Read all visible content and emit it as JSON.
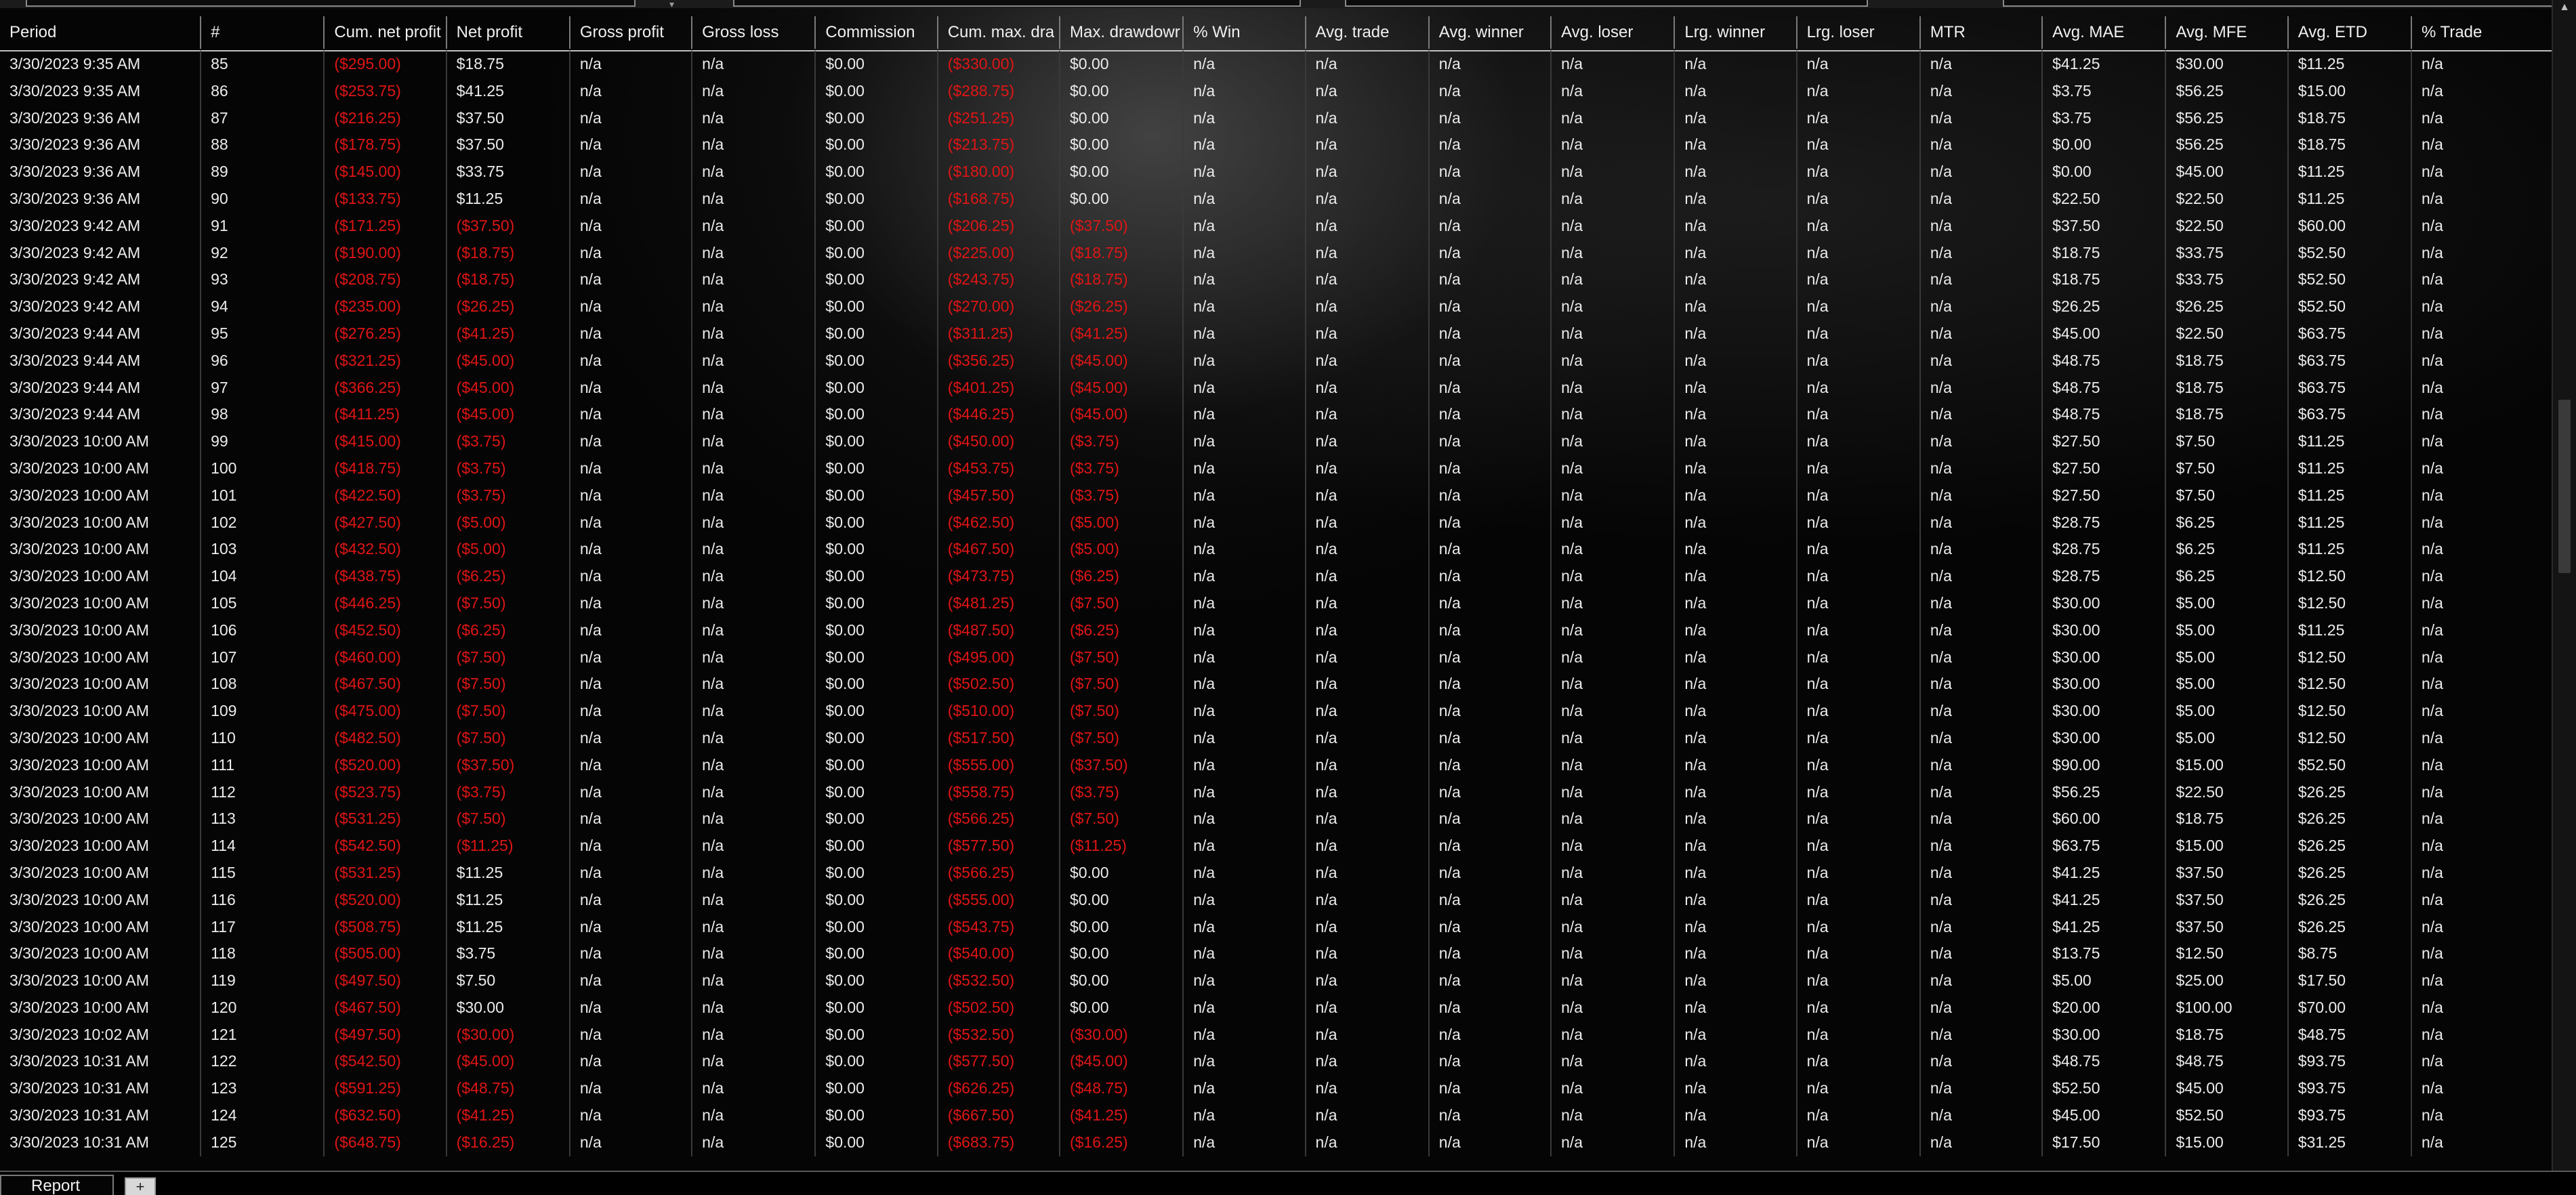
{
  "columns": [
    "Period",
    "#",
    "Cum. net profit",
    "Net profit",
    "Gross profit",
    "Gross loss",
    "Commission",
    "Cum. max. dra",
    "Max. drawdowr",
    "% Win",
    "Avg. trade",
    "Avg. winner",
    "Avg. loser",
    "Lrg. winner",
    "Lrg. loser",
    "MTR",
    "Avg. MAE",
    "Avg. MFE",
    "Avg. ETD",
    "% Trade"
  ],
  "rows": [
    [
      "3/30/2023 9:35 AM",
      "85",
      "($295.00)",
      "$18.75",
      "n/a",
      "n/a",
      "$0.00",
      "($330.00)",
      "$0.00",
      "n/a",
      "n/a",
      "n/a",
      "n/a",
      "n/a",
      "n/a",
      "n/a",
      "$41.25",
      "$30.00",
      "$11.25",
      "n/a"
    ],
    [
      "3/30/2023 9:35 AM",
      "86",
      "($253.75)",
      "$41.25",
      "n/a",
      "n/a",
      "$0.00",
      "($288.75)",
      "$0.00",
      "n/a",
      "n/a",
      "n/a",
      "n/a",
      "n/a",
      "n/a",
      "n/a",
      "$3.75",
      "$56.25",
      "$15.00",
      "n/a"
    ],
    [
      "3/30/2023 9:36 AM",
      "87",
      "($216.25)",
      "$37.50",
      "n/a",
      "n/a",
      "$0.00",
      "($251.25)",
      "$0.00",
      "n/a",
      "n/a",
      "n/a",
      "n/a",
      "n/a",
      "n/a",
      "n/a",
      "$3.75",
      "$56.25",
      "$18.75",
      "n/a"
    ],
    [
      "3/30/2023 9:36 AM",
      "88",
      "($178.75)",
      "$37.50",
      "n/a",
      "n/a",
      "$0.00",
      "($213.75)",
      "$0.00",
      "n/a",
      "n/a",
      "n/a",
      "n/a",
      "n/a",
      "n/a",
      "n/a",
      "$0.00",
      "$56.25",
      "$18.75",
      "n/a"
    ],
    [
      "3/30/2023 9:36 AM",
      "89",
      "($145.00)",
      "$33.75",
      "n/a",
      "n/a",
      "$0.00",
      "($180.00)",
      "$0.00",
      "n/a",
      "n/a",
      "n/a",
      "n/a",
      "n/a",
      "n/a",
      "n/a",
      "$0.00",
      "$45.00",
      "$11.25",
      "n/a"
    ],
    [
      "3/30/2023 9:36 AM",
      "90",
      "($133.75)",
      "$11.25",
      "n/a",
      "n/a",
      "$0.00",
      "($168.75)",
      "$0.00",
      "n/a",
      "n/a",
      "n/a",
      "n/a",
      "n/a",
      "n/a",
      "n/a",
      "$22.50",
      "$22.50",
      "$11.25",
      "n/a"
    ],
    [
      "3/30/2023 9:42 AM",
      "91",
      "($171.25)",
      "($37.50)",
      "n/a",
      "n/a",
      "$0.00",
      "($206.25)",
      "($37.50)",
      "n/a",
      "n/a",
      "n/a",
      "n/a",
      "n/a",
      "n/a",
      "n/a",
      "$37.50",
      "$22.50",
      "$60.00",
      "n/a"
    ],
    [
      "3/30/2023 9:42 AM",
      "92",
      "($190.00)",
      "($18.75)",
      "n/a",
      "n/a",
      "$0.00",
      "($225.00)",
      "($18.75)",
      "n/a",
      "n/a",
      "n/a",
      "n/a",
      "n/a",
      "n/a",
      "n/a",
      "$18.75",
      "$33.75",
      "$52.50",
      "n/a"
    ],
    [
      "3/30/2023 9:42 AM",
      "93",
      "($208.75)",
      "($18.75)",
      "n/a",
      "n/a",
      "$0.00",
      "($243.75)",
      "($18.75)",
      "n/a",
      "n/a",
      "n/a",
      "n/a",
      "n/a",
      "n/a",
      "n/a",
      "$18.75",
      "$33.75",
      "$52.50",
      "n/a"
    ],
    [
      "3/30/2023 9:42 AM",
      "94",
      "($235.00)",
      "($26.25)",
      "n/a",
      "n/a",
      "$0.00",
      "($270.00)",
      "($26.25)",
      "n/a",
      "n/a",
      "n/a",
      "n/a",
      "n/a",
      "n/a",
      "n/a",
      "$26.25",
      "$26.25",
      "$52.50",
      "n/a"
    ],
    [
      "3/30/2023 9:44 AM",
      "95",
      "($276.25)",
      "($41.25)",
      "n/a",
      "n/a",
      "$0.00",
      "($311.25)",
      "($41.25)",
      "n/a",
      "n/a",
      "n/a",
      "n/a",
      "n/a",
      "n/a",
      "n/a",
      "$45.00",
      "$22.50",
      "$63.75",
      "n/a"
    ],
    [
      "3/30/2023 9:44 AM",
      "96",
      "($321.25)",
      "($45.00)",
      "n/a",
      "n/a",
      "$0.00",
      "($356.25)",
      "($45.00)",
      "n/a",
      "n/a",
      "n/a",
      "n/a",
      "n/a",
      "n/a",
      "n/a",
      "$48.75",
      "$18.75",
      "$63.75",
      "n/a"
    ],
    [
      "3/30/2023 9:44 AM",
      "97",
      "($366.25)",
      "($45.00)",
      "n/a",
      "n/a",
      "$0.00",
      "($401.25)",
      "($45.00)",
      "n/a",
      "n/a",
      "n/a",
      "n/a",
      "n/a",
      "n/a",
      "n/a",
      "$48.75",
      "$18.75",
      "$63.75",
      "n/a"
    ],
    [
      "3/30/2023 9:44 AM",
      "98",
      "($411.25)",
      "($45.00)",
      "n/a",
      "n/a",
      "$0.00",
      "($446.25)",
      "($45.00)",
      "n/a",
      "n/a",
      "n/a",
      "n/a",
      "n/a",
      "n/a",
      "n/a",
      "$48.75",
      "$18.75",
      "$63.75",
      "n/a"
    ],
    [
      "3/30/2023 10:00 AM",
      "99",
      "($415.00)",
      "($3.75)",
      "n/a",
      "n/a",
      "$0.00",
      "($450.00)",
      "($3.75)",
      "n/a",
      "n/a",
      "n/a",
      "n/a",
      "n/a",
      "n/a",
      "n/a",
      "$27.50",
      "$7.50",
      "$11.25",
      "n/a"
    ],
    [
      "3/30/2023 10:00 AM",
      "100",
      "($418.75)",
      "($3.75)",
      "n/a",
      "n/a",
      "$0.00",
      "($453.75)",
      "($3.75)",
      "n/a",
      "n/a",
      "n/a",
      "n/a",
      "n/a",
      "n/a",
      "n/a",
      "$27.50",
      "$7.50",
      "$11.25",
      "n/a"
    ],
    [
      "3/30/2023 10:00 AM",
      "101",
      "($422.50)",
      "($3.75)",
      "n/a",
      "n/a",
      "$0.00",
      "($457.50)",
      "($3.75)",
      "n/a",
      "n/a",
      "n/a",
      "n/a",
      "n/a",
      "n/a",
      "n/a",
      "$27.50",
      "$7.50",
      "$11.25",
      "n/a"
    ],
    [
      "3/30/2023 10:00 AM",
      "102",
      "($427.50)",
      "($5.00)",
      "n/a",
      "n/a",
      "$0.00",
      "($462.50)",
      "($5.00)",
      "n/a",
      "n/a",
      "n/a",
      "n/a",
      "n/a",
      "n/a",
      "n/a",
      "$28.75",
      "$6.25",
      "$11.25",
      "n/a"
    ],
    [
      "3/30/2023 10:00 AM",
      "103",
      "($432.50)",
      "($5.00)",
      "n/a",
      "n/a",
      "$0.00",
      "($467.50)",
      "($5.00)",
      "n/a",
      "n/a",
      "n/a",
      "n/a",
      "n/a",
      "n/a",
      "n/a",
      "$28.75",
      "$6.25",
      "$11.25",
      "n/a"
    ],
    [
      "3/30/2023 10:00 AM",
      "104",
      "($438.75)",
      "($6.25)",
      "n/a",
      "n/a",
      "$0.00",
      "($473.75)",
      "($6.25)",
      "n/a",
      "n/a",
      "n/a",
      "n/a",
      "n/a",
      "n/a",
      "n/a",
      "$28.75",
      "$6.25",
      "$12.50",
      "n/a"
    ],
    [
      "3/30/2023 10:00 AM",
      "105",
      "($446.25)",
      "($7.50)",
      "n/a",
      "n/a",
      "$0.00",
      "($481.25)",
      "($7.50)",
      "n/a",
      "n/a",
      "n/a",
      "n/a",
      "n/a",
      "n/a",
      "n/a",
      "$30.00",
      "$5.00",
      "$12.50",
      "n/a"
    ],
    [
      "3/30/2023 10:00 AM",
      "106",
      "($452.50)",
      "($6.25)",
      "n/a",
      "n/a",
      "$0.00",
      "($487.50)",
      "($6.25)",
      "n/a",
      "n/a",
      "n/a",
      "n/a",
      "n/a",
      "n/a",
      "n/a",
      "$30.00",
      "$5.00",
      "$11.25",
      "n/a"
    ],
    [
      "3/30/2023 10:00 AM",
      "107",
      "($460.00)",
      "($7.50)",
      "n/a",
      "n/a",
      "$0.00",
      "($495.00)",
      "($7.50)",
      "n/a",
      "n/a",
      "n/a",
      "n/a",
      "n/a",
      "n/a",
      "n/a",
      "$30.00",
      "$5.00",
      "$12.50",
      "n/a"
    ],
    [
      "3/30/2023 10:00 AM",
      "108",
      "($467.50)",
      "($7.50)",
      "n/a",
      "n/a",
      "$0.00",
      "($502.50)",
      "($7.50)",
      "n/a",
      "n/a",
      "n/a",
      "n/a",
      "n/a",
      "n/a",
      "n/a",
      "$30.00",
      "$5.00",
      "$12.50",
      "n/a"
    ],
    [
      "3/30/2023 10:00 AM",
      "109",
      "($475.00)",
      "($7.50)",
      "n/a",
      "n/a",
      "$0.00",
      "($510.00)",
      "($7.50)",
      "n/a",
      "n/a",
      "n/a",
      "n/a",
      "n/a",
      "n/a",
      "n/a",
      "$30.00",
      "$5.00",
      "$12.50",
      "n/a"
    ],
    [
      "3/30/2023 10:00 AM",
      "110",
      "($482.50)",
      "($7.50)",
      "n/a",
      "n/a",
      "$0.00",
      "($517.50)",
      "($7.50)",
      "n/a",
      "n/a",
      "n/a",
      "n/a",
      "n/a",
      "n/a",
      "n/a",
      "$30.00",
      "$5.00",
      "$12.50",
      "n/a"
    ],
    [
      "3/30/2023 10:00 AM",
      "111",
      "($520.00)",
      "($37.50)",
      "n/a",
      "n/a",
      "$0.00",
      "($555.00)",
      "($37.50)",
      "n/a",
      "n/a",
      "n/a",
      "n/a",
      "n/a",
      "n/a",
      "n/a",
      "$90.00",
      "$15.00",
      "$52.50",
      "n/a"
    ],
    [
      "3/30/2023 10:00 AM",
      "112",
      "($523.75)",
      "($3.75)",
      "n/a",
      "n/a",
      "$0.00",
      "($558.75)",
      "($3.75)",
      "n/a",
      "n/a",
      "n/a",
      "n/a",
      "n/a",
      "n/a",
      "n/a",
      "$56.25",
      "$22.50",
      "$26.25",
      "n/a"
    ],
    [
      "3/30/2023 10:00 AM",
      "113",
      "($531.25)",
      "($7.50)",
      "n/a",
      "n/a",
      "$0.00",
      "($566.25)",
      "($7.50)",
      "n/a",
      "n/a",
      "n/a",
      "n/a",
      "n/a",
      "n/a",
      "n/a",
      "$60.00",
      "$18.75",
      "$26.25",
      "n/a"
    ],
    [
      "3/30/2023 10:00 AM",
      "114",
      "($542.50)",
      "($11.25)",
      "n/a",
      "n/a",
      "$0.00",
      "($577.50)",
      "($11.25)",
      "n/a",
      "n/a",
      "n/a",
      "n/a",
      "n/a",
      "n/a",
      "n/a",
      "$63.75",
      "$15.00",
      "$26.25",
      "n/a"
    ],
    [
      "3/30/2023 10:00 AM",
      "115",
      "($531.25)",
      "$11.25",
      "n/a",
      "n/a",
      "$0.00",
      "($566.25)",
      "$0.00",
      "n/a",
      "n/a",
      "n/a",
      "n/a",
      "n/a",
      "n/a",
      "n/a",
      "$41.25",
      "$37.50",
      "$26.25",
      "n/a"
    ],
    [
      "3/30/2023 10:00 AM",
      "116",
      "($520.00)",
      "$11.25",
      "n/a",
      "n/a",
      "$0.00",
      "($555.00)",
      "$0.00",
      "n/a",
      "n/a",
      "n/a",
      "n/a",
      "n/a",
      "n/a",
      "n/a",
      "$41.25",
      "$37.50",
      "$26.25",
      "n/a"
    ],
    [
      "3/30/2023 10:00 AM",
      "117",
      "($508.75)",
      "$11.25",
      "n/a",
      "n/a",
      "$0.00",
      "($543.75)",
      "$0.00",
      "n/a",
      "n/a",
      "n/a",
      "n/a",
      "n/a",
      "n/a",
      "n/a",
      "$41.25",
      "$37.50",
      "$26.25",
      "n/a"
    ],
    [
      "3/30/2023 10:00 AM",
      "118",
      "($505.00)",
      "$3.75",
      "n/a",
      "n/a",
      "$0.00",
      "($540.00)",
      "$0.00",
      "n/a",
      "n/a",
      "n/a",
      "n/a",
      "n/a",
      "n/a",
      "n/a",
      "$13.75",
      "$12.50",
      "$8.75",
      "n/a"
    ],
    [
      "3/30/2023 10:00 AM",
      "119",
      "($497.50)",
      "$7.50",
      "n/a",
      "n/a",
      "$0.00",
      "($532.50)",
      "$0.00",
      "n/a",
      "n/a",
      "n/a",
      "n/a",
      "n/a",
      "n/a",
      "n/a",
      "$5.00",
      "$25.00",
      "$17.50",
      "n/a"
    ],
    [
      "3/30/2023 10:00 AM",
      "120",
      "($467.50)",
      "$30.00",
      "n/a",
      "n/a",
      "$0.00",
      "($502.50)",
      "$0.00",
      "n/a",
      "n/a",
      "n/a",
      "n/a",
      "n/a",
      "n/a",
      "n/a",
      "$20.00",
      "$100.00",
      "$70.00",
      "n/a"
    ],
    [
      "3/30/2023 10:02 AM",
      "121",
      "($497.50)",
      "($30.00)",
      "n/a",
      "n/a",
      "$0.00",
      "($532.50)",
      "($30.00)",
      "n/a",
      "n/a",
      "n/a",
      "n/a",
      "n/a",
      "n/a",
      "n/a",
      "$30.00",
      "$18.75",
      "$48.75",
      "n/a"
    ],
    [
      "3/30/2023 10:31 AM",
      "122",
      "($542.50)",
      "($45.00)",
      "n/a",
      "n/a",
      "$0.00",
      "($577.50)",
      "($45.00)",
      "n/a",
      "n/a",
      "n/a",
      "n/a",
      "n/a",
      "n/a",
      "n/a",
      "$48.75",
      "$48.75",
      "$93.75",
      "n/a"
    ],
    [
      "3/30/2023 10:31 AM",
      "123",
      "($591.25)",
      "($48.75)",
      "n/a",
      "n/a",
      "$0.00",
      "($626.25)",
      "($48.75)",
      "n/a",
      "n/a",
      "n/a",
      "n/a",
      "n/a",
      "n/a",
      "n/a",
      "$52.50",
      "$45.00",
      "$93.75",
      "n/a"
    ],
    [
      "3/30/2023 10:31 AM",
      "124",
      "($632.50)",
      "($41.25)",
      "n/a",
      "n/a",
      "$0.00",
      "($667.50)",
      "($41.25)",
      "n/a",
      "n/a",
      "n/a",
      "n/a",
      "n/a",
      "n/a",
      "n/a",
      "$45.00",
      "$52.50",
      "$93.75",
      "n/a"
    ],
    [
      "3/30/2023 10:31 AM",
      "125",
      "($648.75)",
      "($16.25)",
      "n/a",
      "n/a",
      "$0.00",
      "($683.75)",
      "($16.25)",
      "n/a",
      "n/a",
      "n/a",
      "n/a",
      "n/a",
      "n/a",
      "n/a",
      "$17.50",
      "$15.00",
      "$31.25",
      "n/a"
    ]
  ],
  "negative_color": "#e01515",
  "text_color": "#ececec",
  "tabs": {
    "report_label": "Report",
    "add_tab_icon": "+"
  },
  "scrollbar": {
    "up_icon": "▲"
  },
  "topbar": {
    "dropdown_icon": "▾"
  }
}
